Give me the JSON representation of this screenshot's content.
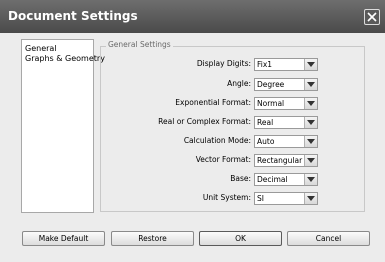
{
  "window": {
    "title": "Document Settings",
    "close_icon": "close-icon"
  },
  "nav": {
    "items": [
      {
        "label": "General"
      },
      {
        "label": "Graphs & Geometry"
      }
    ]
  },
  "general_settings": {
    "group_label": "General Settings",
    "rows": [
      {
        "label": "Display Digits:",
        "value": "Fix1"
      },
      {
        "label": "Angle:",
        "value": "Degree"
      },
      {
        "label": "Exponential Format:",
        "value": "Normal"
      },
      {
        "label": "Real or Complex Format:",
        "value": "Real"
      },
      {
        "label": "Calculation Mode:",
        "value": "Auto"
      },
      {
        "label": "Vector Format:",
        "value": "Rectangular"
      },
      {
        "label": "Base:",
        "value": "Decimal"
      },
      {
        "label": "Unit System:",
        "value": "SI"
      }
    ]
  },
  "buttons": {
    "make_default": "Make Default",
    "restore": "Restore",
    "ok": "OK",
    "cancel": "Cancel"
  }
}
